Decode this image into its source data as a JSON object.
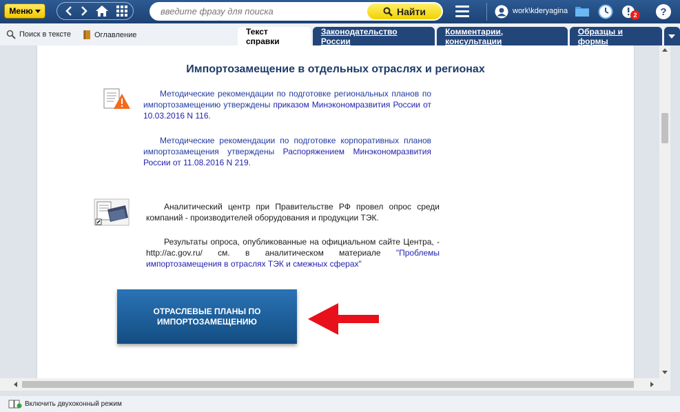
{
  "toolbar": {
    "menu_label": "Меню",
    "search_placeholder": "введите фразу для поиска",
    "find_label": "Найти",
    "username": "work\\kderyagina",
    "notification_count": "2",
    "help_label": "?"
  },
  "secondary": {
    "search_in_text": "Поиск в тексте",
    "contents": "Оглавление"
  },
  "tabs": [
    {
      "label": "Текст справки",
      "active": true
    },
    {
      "label": "Законодательство России",
      "active": false
    },
    {
      "label": "Комментарии, консультации",
      "active": false
    },
    {
      "label": "Образцы и формы",
      "active": false
    }
  ],
  "document": {
    "heading": "Импортозамещение в отдельных отраслях и регионах",
    "block1": {
      "p1_text": "Методические рекомендации по подготовке региональных планов по импортозамещению утверждены ",
      "p1_link": "приказом Минэкономразвития России от 10.03.2016 N 116",
      "p1_end": ".",
      "p2_text": "Методические рекомендации по подготовке корпоративных планов импортозамещения утверждены ",
      "p2_link": "Распоряжением Минэкономразвития России от 11.08.2016 N 219",
      "p2_end": "."
    },
    "block2": {
      "p1": "Аналитический центр при Правительстве РФ провел опрос среди компаний - производителей оборудования и продукции ТЭК.",
      "p2_text": "Результаты опроса, опубликованные на официальном сайте Центра, - http://ac.gov.ru/ см. в аналитическом материале ",
      "p2_link": "\"Проблемы импортозамещения в отраслях ТЭК и смежных сферах\""
    },
    "banner_line1": "ОТРАСЛЕВЫЕ ПЛАНЫ ПО",
    "banner_line2": "ИМПОРТОЗАМЕЩЕНИЮ"
  },
  "statusbar": {
    "dual_window": "Включить двухоконный режим"
  },
  "colors": {
    "toolbar_bg": "#1d4275",
    "accent_yellow": "#f1c800",
    "tab_bg": "#22457a",
    "arrow_red": "#e8101a",
    "banner_blue": "#1a5d9c"
  }
}
